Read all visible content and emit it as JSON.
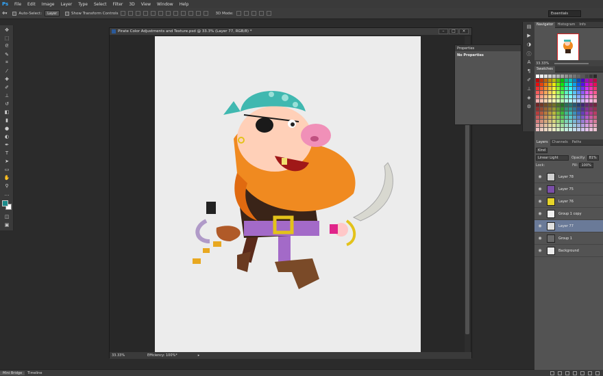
{
  "app": {
    "logo": "Ps",
    "menu": [
      "File",
      "Edit",
      "Image",
      "Layer",
      "Type",
      "Select",
      "Filter",
      "3D",
      "View",
      "Window",
      "Help"
    ]
  },
  "options": {
    "auto_select_label": "Auto-Select:",
    "auto_select_value": "Layer",
    "transform_label": "Show Transform Controls",
    "mode_3d_label": "3D Mode:",
    "workspace": "Essentials"
  },
  "document": {
    "title": "Pirate Color Adjustments and Texture.psd @ 33.3% (Layer 77, RGB/8) *",
    "zoom": "33.33%",
    "status": "Efficiency: 100%*"
  },
  "properties": {
    "tab": "Properties",
    "body": "No Properties"
  },
  "navigator": {
    "tabs": [
      "Navigator",
      "Histogram",
      "Info"
    ],
    "zoom": "33.33%"
  },
  "swatches": {
    "tab": "Swatches"
  },
  "layers_panel": {
    "tabs": [
      "Layers",
      "Channels",
      "Paths"
    ],
    "kind_label": "Kind",
    "blend_mode": "Linear Light",
    "opacity_label": "Opacity:",
    "opacity_value": "81%",
    "lock_label": "Lock:",
    "fill_label": "Fill:",
    "fill_value": "100%",
    "layers": [
      {
        "name": "Layer 78",
        "thumb": "#cfcfcf",
        "selected": false
      },
      {
        "name": "Layer 75",
        "thumb": "#7b4fa8",
        "selected": false
      },
      {
        "name": "Layer 76",
        "thumb": "#e7d52a",
        "selected": false
      },
      {
        "name": "Group 1 copy",
        "thumb": "#f0f0f0",
        "selected": false
      },
      {
        "name": "Layer 77",
        "thumb": "#e0e0e0",
        "selected": true
      },
      {
        "name": "Group 1",
        "thumb": "#6a6a6a",
        "selected": false
      },
      {
        "name": "Background",
        "thumb": "#ececec",
        "selected": false
      }
    ]
  },
  "bottom_tabs": [
    "Mini Bridge",
    "Timeline"
  ]
}
